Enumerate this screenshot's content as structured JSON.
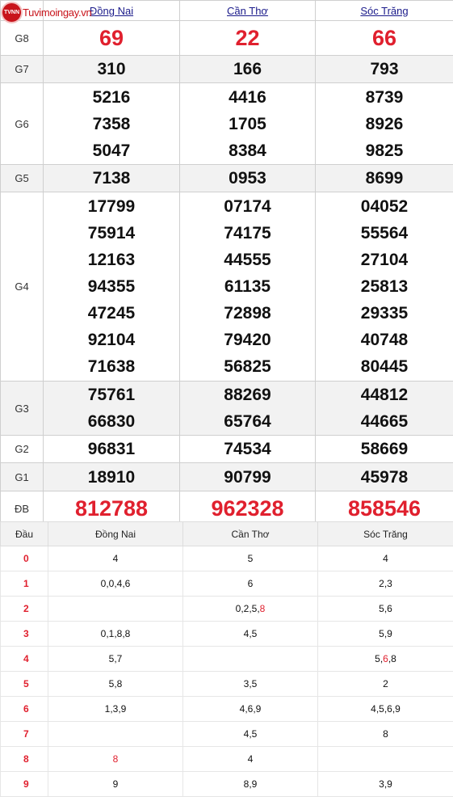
{
  "logo": {
    "mark": "TVNN",
    "text": "Tuvimoingay.vn"
  },
  "provinces": [
    "Đồng Nai",
    "Cần Thơ",
    "Sóc Trăng"
  ],
  "prizes": [
    {
      "label": "G8",
      "values": [
        [
          "69"
        ],
        [
          "22"
        ],
        [
          "66"
        ]
      ],
      "style": "big-red"
    },
    {
      "label": "G7",
      "values": [
        [
          "310"
        ],
        [
          "166"
        ],
        [
          "793"
        ]
      ]
    },
    {
      "label": "G6",
      "values": [
        [
          "5216",
          "7358",
          "5047"
        ],
        [
          "4416",
          "1705",
          "8384"
        ],
        [
          "8739",
          "8926",
          "9825"
        ]
      ]
    },
    {
      "label": "G5",
      "values": [
        [
          "7138"
        ],
        [
          "0953"
        ],
        [
          "8699"
        ]
      ]
    },
    {
      "label": "G4",
      "values": [
        [
          "17799",
          "75914",
          "12163",
          "94355",
          "47245",
          "92104",
          "71638"
        ],
        [
          "07174",
          "74175",
          "44555",
          "61135",
          "72898",
          "79420",
          "56825"
        ],
        [
          "04052",
          "55564",
          "27104",
          "25813",
          "29335",
          "40748",
          "80445"
        ]
      ]
    },
    {
      "label": "G3",
      "values": [
        [
          "75761",
          "66830"
        ],
        [
          "88269",
          "65764"
        ],
        [
          "44812",
          "44665"
        ]
      ]
    },
    {
      "label": "G2",
      "values": [
        [
          "96831"
        ],
        [
          "74534"
        ],
        [
          "58669"
        ]
      ]
    },
    {
      "label": "G1",
      "values": [
        [
          "18910"
        ],
        [
          "90799"
        ],
        [
          "45978"
        ]
      ]
    },
    {
      "label": "ĐB",
      "values": [
        [
          "812788"
        ],
        [
          "962328"
        ],
        [
          "858546"
        ]
      ],
      "style": "db-red"
    }
  ],
  "loto": {
    "header": [
      "Đầu",
      "Đồng Nai",
      "Cần Thơ",
      "Sóc Trăng"
    ],
    "rows": [
      {
        "dau": "0",
        "cols": [
          [
            {
              "t": "4"
            }
          ],
          [
            {
              "t": "5"
            }
          ],
          [
            {
              "t": "4"
            }
          ]
        ]
      },
      {
        "dau": "1",
        "cols": [
          [
            {
              "t": "0,0,4,6"
            }
          ],
          [
            {
              "t": "6"
            }
          ],
          [
            {
              "t": "2,3"
            }
          ]
        ]
      },
      {
        "dau": "2",
        "cols": [
          [],
          [
            {
              "t": "0,2,5,"
            },
            {
              "t": "8",
              "hl": true
            }
          ],
          [
            {
              "t": "5,6"
            }
          ]
        ]
      },
      {
        "dau": "3",
        "cols": [
          [
            {
              "t": "0,1,8,8"
            }
          ],
          [
            {
              "t": "4,5"
            }
          ],
          [
            {
              "t": "5,9"
            }
          ]
        ]
      },
      {
        "dau": "4",
        "cols": [
          [
            {
              "t": "5,7"
            }
          ],
          [],
          [
            {
              "t": "5,"
            },
            {
              "t": "6",
              "hl": true
            },
            {
              "t": ",8"
            }
          ]
        ]
      },
      {
        "dau": "5",
        "cols": [
          [
            {
              "t": "5,8"
            }
          ],
          [
            {
              "t": "3,5"
            }
          ],
          [
            {
              "t": "2"
            }
          ]
        ]
      },
      {
        "dau": "6",
        "cols": [
          [
            {
              "t": "1,3,9"
            }
          ],
          [
            {
              "t": "4,6,9"
            }
          ],
          [
            {
              "t": "4,5,6,9"
            }
          ]
        ]
      },
      {
        "dau": "7",
        "cols": [
          [],
          [
            {
              "t": "4,5"
            }
          ],
          [
            {
              "t": "8"
            }
          ]
        ]
      },
      {
        "dau": "8",
        "cols": [
          [
            {
              "t": "8",
              "hl": true
            }
          ],
          [
            {
              "t": "4"
            }
          ],
          []
        ]
      },
      {
        "dau": "9",
        "cols": [
          [
            {
              "t": "9"
            }
          ],
          [
            {
              "t": "8,9"
            }
          ],
          [
            {
              "t": "3,9"
            }
          ]
        ]
      }
    ]
  },
  "colors": {
    "accent_red": "#e0202e",
    "header_blue": "#1a1a8a",
    "alt_row": "#f2f2f2"
  }
}
